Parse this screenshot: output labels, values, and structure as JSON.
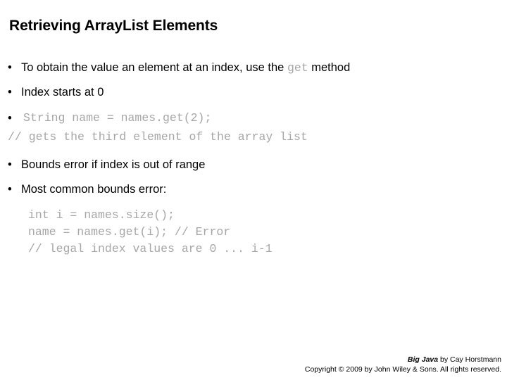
{
  "slide": {
    "title": "Retrieving ArrayList Elements",
    "bullet_char": "•",
    "bullets": [
      {
        "id": "get-method",
        "text_before": "To obtain the value an element at an index, use the ",
        "code": "get",
        "text_after": "  method"
      },
      {
        "id": "index-starts",
        "text": "Index starts at 0"
      },
      {
        "id": "bounds-error",
        "text": "Bounds error if index is out of range"
      },
      {
        "id": "most-common",
        "text": "Most common bounds error:"
      }
    ],
    "code_sample_1": {
      "line1": "String name = names.get(2);",
      "line2": "// gets the third element of the array list"
    },
    "code_sample_2": {
      "line1": "int i = names.size();",
      "line2": "name = names.get(i); // Error",
      "line3": "// legal index values are 0 ... i-1"
    }
  },
  "footer": {
    "book_title": "Big Java",
    "byline": " by Cay Horstmann",
    "copyright": "Copyright © 2009 by John Wiley & Sons.  All rights reserved."
  },
  "colors": {
    "background": "#ffffff",
    "text": "#000000",
    "code_gray": "#a6a6a6"
  }
}
